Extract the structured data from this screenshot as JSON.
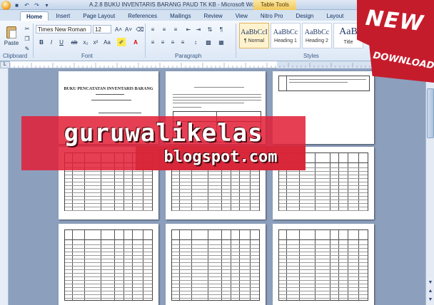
{
  "window": {
    "title": "A.2.8 BUKU INVENTARIS BARANG PAUD TK KB - Microsoft Word",
    "context_tab": "Table Tools"
  },
  "ribbon_tabs": [
    {
      "label": "Home",
      "active": true
    },
    {
      "label": "Insert"
    },
    {
      "label": "Page Layout"
    },
    {
      "label": "References"
    },
    {
      "label": "Mailings"
    },
    {
      "label": "Review"
    },
    {
      "label": "View"
    },
    {
      "label": "Nitro Pro"
    },
    {
      "label": "Design"
    },
    {
      "label": "Layout"
    }
  ],
  "ribbon": {
    "paste_label": "Paste",
    "font_name": "Times New Roman",
    "font_size": "12",
    "groups": {
      "clipboard": "Clipboard",
      "font": "Font",
      "paragraph": "Paragraph",
      "styles": "Styles"
    },
    "styles": [
      {
        "preview": "AaBbCcI",
        "name": "¶ Normal",
        "selected": true
      },
      {
        "preview": "AaBbCc",
        "name": "Heading 1"
      },
      {
        "preview": "AaBbCc",
        "name": "Heading 2"
      },
      {
        "preview": "AaB",
        "name": "Title"
      }
    ]
  },
  "ruler_corner": "L",
  "documents": {
    "page1_title": "BUKU PENCATATAN INVENTARIS BARANG"
  },
  "watermark": {
    "line1": "guruwalikelas",
    "line2": "blogspot.com"
  },
  "badge": {
    "new": "NEW",
    "download": "DOWNLOAD"
  }
}
